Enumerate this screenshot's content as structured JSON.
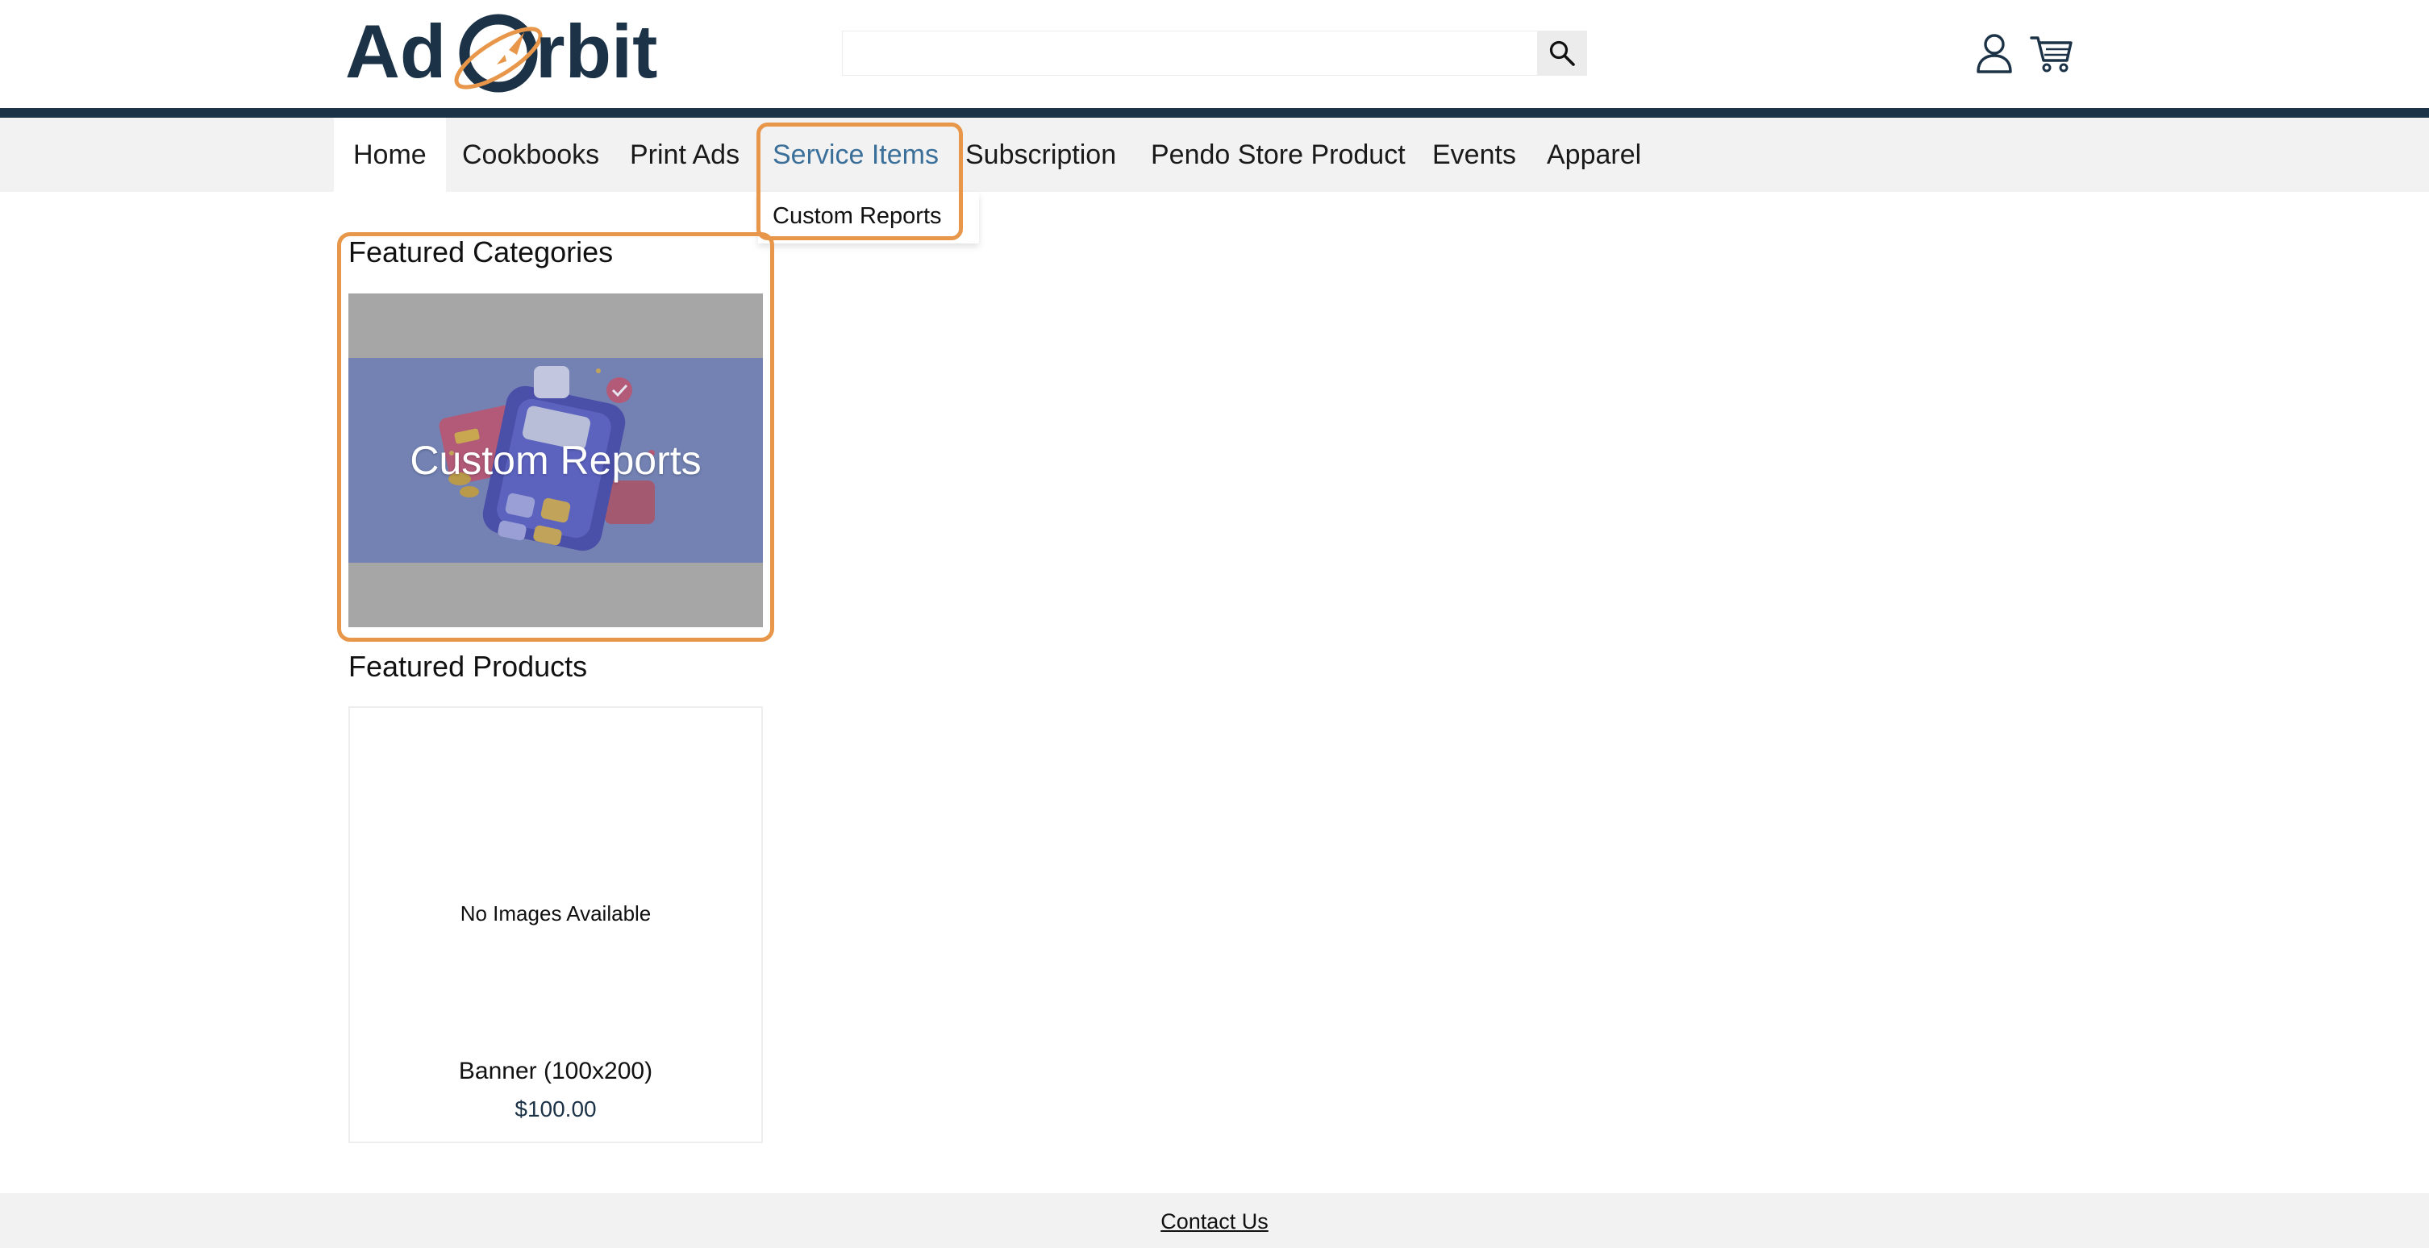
{
  "header": {
    "logo_text_left": "Ad",
    "logo_text_right": "rbit",
    "search": {
      "value": "",
      "placeholder": ""
    },
    "icons": {
      "search": "search-icon",
      "account": "user-icon",
      "cart": "cart-icon"
    }
  },
  "nav": {
    "items": [
      {
        "label": "Home",
        "state": "active"
      },
      {
        "label": "Cookbooks"
      },
      {
        "label": "Print Ads"
      },
      {
        "label": "Service Items",
        "state": "hover"
      },
      {
        "label": "Subscription"
      },
      {
        "label": "Pendo Store Product"
      },
      {
        "label": "Events"
      },
      {
        "label": "Apparel"
      }
    ],
    "dropdown": {
      "items": [
        {
          "label": "Custom Reports"
        }
      ]
    }
  },
  "featured_categories": {
    "title": "Featured Categories",
    "cards": [
      {
        "label": "Custom Reports"
      }
    ]
  },
  "featured_products": {
    "title": "Featured Products",
    "products": [
      {
        "image_text": "No Images Available",
        "name": "Banner (100x200)",
        "price": "$100.00"
      }
    ]
  },
  "footer": {
    "contact_label": "Contact Us"
  },
  "colors": {
    "brand_navy": "#1c3247",
    "brand_orange": "#e8974a",
    "nav_background": "#f2f2f2",
    "nav_hover_text": "#3a6f9a",
    "category_overlay": "#7382b3"
  }
}
